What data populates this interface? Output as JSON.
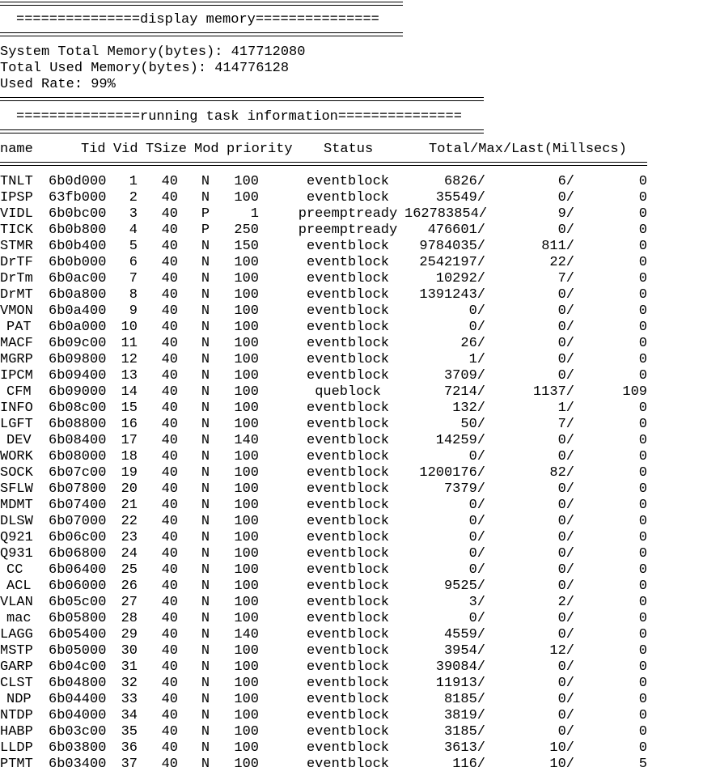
{
  "memory": {
    "header": "===============display memory===============",
    "total_line": "System Total Memory(bytes): 417712080",
    "used_line": "Total Used Memory(bytes): 414776128",
    "rate_line": "Used Rate: 99%"
  },
  "tasks": {
    "header": "===============running task information===============",
    "columns": [
      "name",
      "Tid",
      "Vid",
      "TSize",
      "Mod",
      "priority",
      "Status",
      "Total/Max/Last(Millsecs)"
    ],
    "rows": [
      [
        "TNLT",
        "6b0d000",
        "1",
        "40",
        "N",
        "100",
        "eventblock",
        "6826/",
        "6/",
        "0"
      ],
      [
        "IPSP",
        "63fb000",
        "2",
        "40",
        "N",
        "100",
        "eventblock",
        "35549/",
        "0/",
        "0"
      ],
      [
        "VIDL",
        "6b0bc00",
        "3",
        "40",
        "P",
        "1",
        "preemptready",
        "162783854/",
        "9/",
        "0"
      ],
      [
        "TICK",
        "6b0b800",
        "4",
        "40",
        "P",
        "250",
        "preemptready",
        "476601/",
        "0/",
        "0"
      ],
      [
        "STMR",
        "6b0b400",
        "5",
        "40",
        "N",
        "150",
        "eventblock",
        "9784035/",
        "811/",
        "0"
      ],
      [
        "DrTF",
        "6b0b000",
        "6",
        "40",
        "N",
        "100",
        "eventblock",
        "2542197/",
        "22/",
        "0"
      ],
      [
        "DrTm",
        "6b0ac00",
        "7",
        "40",
        "N",
        "100",
        "eventblock",
        "10292/",
        "7/",
        "0"
      ],
      [
        "DrMT",
        "6b0a800",
        "8",
        "40",
        "N",
        "100",
        "eventblock",
        "1391243/",
        "0/",
        "0"
      ],
      [
        "VMON",
        "6b0a400",
        "9",
        "40",
        "N",
        "100",
        "eventblock",
        "0/",
        "0/",
        "0"
      ],
      [
        "PAT",
        "6b0a000",
        "10",
        "40",
        "N",
        "100",
        "eventblock",
        "0/",
        "0/",
        "0"
      ],
      [
        "MACF",
        "6b09c00",
        "11",
        "40",
        "N",
        "100",
        "eventblock",
        "26/",
        "0/",
        "0"
      ],
      [
        "MGRP",
        "6b09800",
        "12",
        "40",
        "N",
        "100",
        "eventblock",
        "1/",
        "0/",
        "0"
      ],
      [
        "IPCM",
        "6b09400",
        "13",
        "40",
        "N",
        "100",
        "eventblock",
        "3709/",
        "0/",
        "0"
      ],
      [
        "CFM",
        "6b09000",
        "14",
        "40",
        "N",
        "100",
        "queblock",
        "7214/",
        "1137/",
        "109"
      ],
      [
        "INFO",
        "6b08c00",
        "15",
        "40",
        "N",
        "100",
        "eventblock",
        "132/",
        "1/",
        "0"
      ],
      [
        "LGFT",
        "6b08800",
        "16",
        "40",
        "N",
        "100",
        "eventblock",
        "50/",
        "7/",
        "0"
      ],
      [
        "DEV",
        "6b08400",
        "17",
        "40",
        "N",
        "140",
        "eventblock",
        "14259/",
        "0/",
        "0"
      ],
      [
        "WORK",
        "6b08000",
        "18",
        "40",
        "N",
        "100",
        "eventblock",
        "0/",
        "0/",
        "0"
      ],
      [
        "SOCK",
        "6b07c00",
        "19",
        "40",
        "N",
        "100",
        "eventblock",
        "1200176/",
        "82/",
        "0"
      ],
      [
        "SFLW",
        "6b07800",
        "20",
        "40",
        "N",
        "100",
        "eventblock",
        "7379/",
        "0/",
        "0"
      ],
      [
        "MDMT",
        "6b07400",
        "21",
        "40",
        "N",
        "100",
        "eventblock",
        "0/",
        "0/",
        "0"
      ],
      [
        "DLSW",
        "6b07000",
        "22",
        "40",
        "N",
        "100",
        "eventblock",
        "0/",
        "0/",
        "0"
      ],
      [
        "Q921",
        "6b06c00",
        "23",
        "40",
        "N",
        "100",
        "eventblock",
        "0/",
        "0/",
        "0"
      ],
      [
        "Q931",
        "6b06800",
        "24",
        "40",
        "N",
        "100",
        "eventblock",
        "0/",
        "0/",
        "0"
      ],
      [
        "CC",
        "6b06400",
        "25",
        "40",
        "N",
        "100",
        "eventblock",
        "0/",
        "0/",
        "0"
      ],
      [
        "ACL",
        "6b06000",
        "26",
        "40",
        "N",
        "100",
        "eventblock",
        "9525/",
        "0/",
        "0"
      ],
      [
        "VLAN",
        "6b05c00",
        "27",
        "40",
        "N",
        "100",
        "eventblock",
        "3/",
        "2/",
        "0"
      ],
      [
        "mac",
        "6b05800",
        "28",
        "40",
        "N",
        "100",
        "eventblock",
        "0/",
        "0/",
        "0"
      ],
      [
        "LAGG",
        "6b05400",
        "29",
        "40",
        "N",
        "140",
        "eventblock",
        "4559/",
        "0/",
        "0"
      ],
      [
        "MSTP",
        "6b05000",
        "30",
        "40",
        "N",
        "100",
        "eventblock",
        "3954/",
        "12/",
        "0"
      ],
      [
        "GARP",
        "6b04c00",
        "31",
        "40",
        "N",
        "100",
        "eventblock",
        "39084/",
        "0/",
        "0"
      ],
      [
        "CLST",
        "6b04800",
        "32",
        "40",
        "N",
        "100",
        "eventblock",
        "11913/",
        "0/",
        "0"
      ],
      [
        "NDP",
        "6b04400",
        "33",
        "40",
        "N",
        "100",
        "eventblock",
        "8185/",
        "0/",
        "0"
      ],
      [
        "NTDP",
        "6b04000",
        "34",
        "40",
        "N",
        "100",
        "eventblock",
        "3819/",
        "0/",
        "0"
      ],
      [
        "HABP",
        "6b03c00",
        "35",
        "40",
        "N",
        "100",
        "eventblock",
        "3185/",
        "0/",
        "0"
      ],
      [
        "LLDP",
        "6b03800",
        "36",
        "40",
        "N",
        "100",
        "eventblock",
        "3613/",
        "10/",
        "0"
      ],
      [
        "PTMT",
        "6b03400",
        "37",
        "40",
        "N",
        "100",
        "eventblock",
        "116/",
        "10/",
        "5"
      ]
    ]
  }
}
